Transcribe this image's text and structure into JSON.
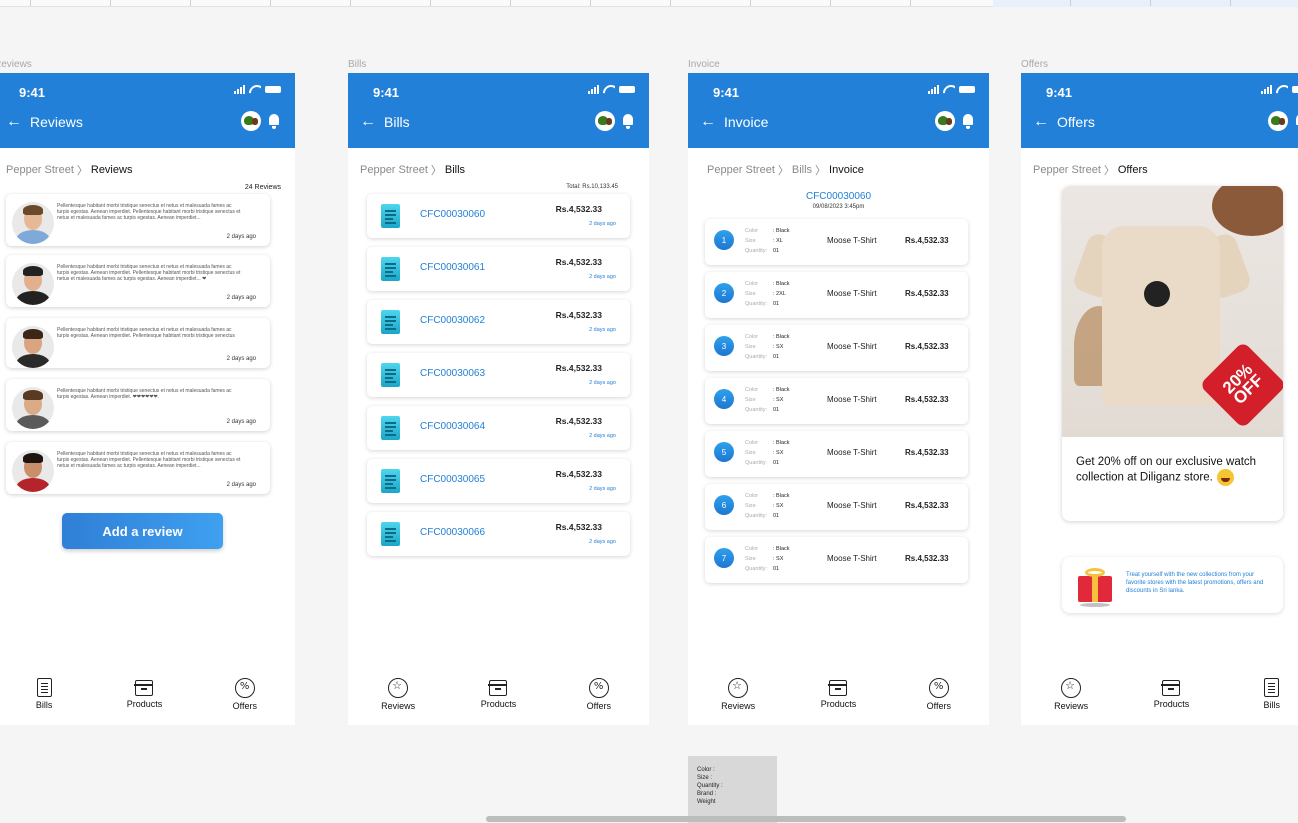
{
  "status": {
    "time": "9:41"
  },
  "frames": {
    "reviews": {
      "label": "Reviews",
      "title": "Reviews",
      "breadcrumb": {
        "root": "Pepper Street",
        "current": "Reviews"
      },
      "count": "24 Reviews",
      "cards": [
        {
          "text": "Pellentesque habitant morbi tristique senectus et netus et malesuada fames ac turpis egestas. Aenean imperdiet. Pellentesque habitant morbi tristique senectus et netus et malesuada fames ac turpis egestas. Aenean imperdiet...",
          "ago": "2 days ago"
        },
        {
          "text": "Pellentesque habitant morbi tristique senectus et netus et malesuada fames ac turpis egestas. Aenean imperdiet. Pellentesque habitant morbi tristique senectus et netus et malesuada fames ac turpis egestas. Aenean imperdiet... ❤",
          "ago": "2 days ago"
        },
        {
          "text": "Pellentesque habitant morbi tristique senectus et netus et malesuada fames ac turpis egestas. Aenean imperdiet. Pellentesque habitant morbi tristique senectus",
          "ago": "2 days ago"
        },
        {
          "text": "Pellentesque habitant morbi tristique senectus et netus et malesuada fames ac turpis egestas. Aenean imperdiet. ❤❤❤❤❤❤.",
          "ago": "2 days ago"
        },
        {
          "text": "Pellentesque habitant morbi tristique senectus et netus et malesuada fames ac turpis egestas. Aenean imperdiet. Pellentesque habitant morbi tristique senectus et netus et malesuada fames ac turpis egestas. Aenean imperdiet...",
          "ago": "2 days ago"
        }
      ],
      "add_button": "Add a review",
      "nav": [
        "Bills",
        "Products",
        "Offers"
      ]
    },
    "bills": {
      "label": "Bills",
      "title": "Bills",
      "breadcrumb": {
        "root": "Pepper Street",
        "current": "Bills"
      },
      "total": "Total: Rs.10,133.45",
      "items": [
        {
          "code": "CFC00030060",
          "amount": "Rs.4,532.33",
          "ago": "2 days ago"
        },
        {
          "code": "CFC00030061",
          "amount": "Rs.4,532.33",
          "ago": "2 days ago"
        },
        {
          "code": "CFC00030062",
          "amount": "Rs.4,532.33",
          "ago": "2 days ago"
        },
        {
          "code": "CFC00030063",
          "amount": "Rs.4,532.33",
          "ago": "2 days ago"
        },
        {
          "code": "CFC00030064",
          "amount": "Rs.4,532.33",
          "ago": "2 days ago"
        },
        {
          "code": "CFC00030065",
          "amount": "Rs.4,532.33",
          "ago": "2 days ago"
        },
        {
          "code": "CFC00030066",
          "amount": "Rs.4,532.33",
          "ago": "2 days ago"
        }
      ],
      "nav": [
        "Reviews",
        "Products",
        "Offers"
      ]
    },
    "invoice": {
      "label": "Invoice",
      "title": "Invoice",
      "breadcrumb": {
        "root": "Pepper Street",
        "mid": "Bills",
        "current": "Invoice"
      },
      "number": "CFC00030060",
      "date": "09/08/2023 3:45pm",
      "labels": {
        "color": "Color",
        "size": "Size",
        "quantity": "Quantity:"
      },
      "items": [
        {
          "n": "1",
          "color": ": Black",
          "size": ": XL",
          "qty": "01",
          "product": "Moose T-Shirt",
          "price": "Rs.4,532.33"
        },
        {
          "n": "2",
          "color": ": Black",
          "size": ": 2XL",
          "qty": "01",
          "product": "Moose T-Shirt",
          "price": "Rs.4,532.33"
        },
        {
          "n": "3",
          "color": ": Black",
          "size": ": SX",
          "qty": "01",
          "product": "Moose T-Shirt",
          "price": "Rs.4,532.33"
        },
        {
          "n": "4",
          "color": ": Black",
          "size": ": SX",
          "qty": "01",
          "product": "Moose T-Shirt",
          "price": "Rs.4,532.33"
        },
        {
          "n": "5",
          "color": ": Black",
          "size": ": SX",
          "qty": "01",
          "product": "Moose T-Shirt",
          "price": "Rs.4,532.33"
        },
        {
          "n": "6",
          "color": ": Black",
          "size": ": SX",
          "qty": "01",
          "product": "Moose T-Shirt",
          "price": "Rs.4,532.33"
        },
        {
          "n": "7",
          "color": ": Black",
          "size": ": SX",
          "qty": "01",
          "product": "Moose T-Shirt",
          "price": "Rs.4,532.33"
        }
      ],
      "nav": [
        "Reviews",
        "Products",
        "Offers"
      ]
    },
    "offers": {
      "label": "Offers",
      "title": "Offers",
      "breadcrumb": {
        "root": "Pepper Street",
        "current": "Offers"
      },
      "badge": "20% OFF",
      "offer_text": "Get 20% off on our exclusive watch collection at Diliganz store.",
      "promo_text": "Treat yourself with the new collections from your favorite stores with the latest promotions, offers and discounts in Sri lanka.",
      "nav": [
        "Reviews",
        "Products",
        "Bills"
      ]
    }
  },
  "popup": {
    "lines": [
      "Color   :",
      "Size    :",
      "Quantity :",
      "Brand  :",
      "Weight"
    ]
  },
  "colors": {
    "primary": "#2280d8",
    "badge": "#d21f2a"
  },
  "icons": [
    "arrow-left-icon",
    "logo-icon",
    "bell-icon",
    "bill-document-icon",
    "star-chat-icon",
    "products-box-icon",
    "percent-icon",
    "gift-icon"
  ]
}
